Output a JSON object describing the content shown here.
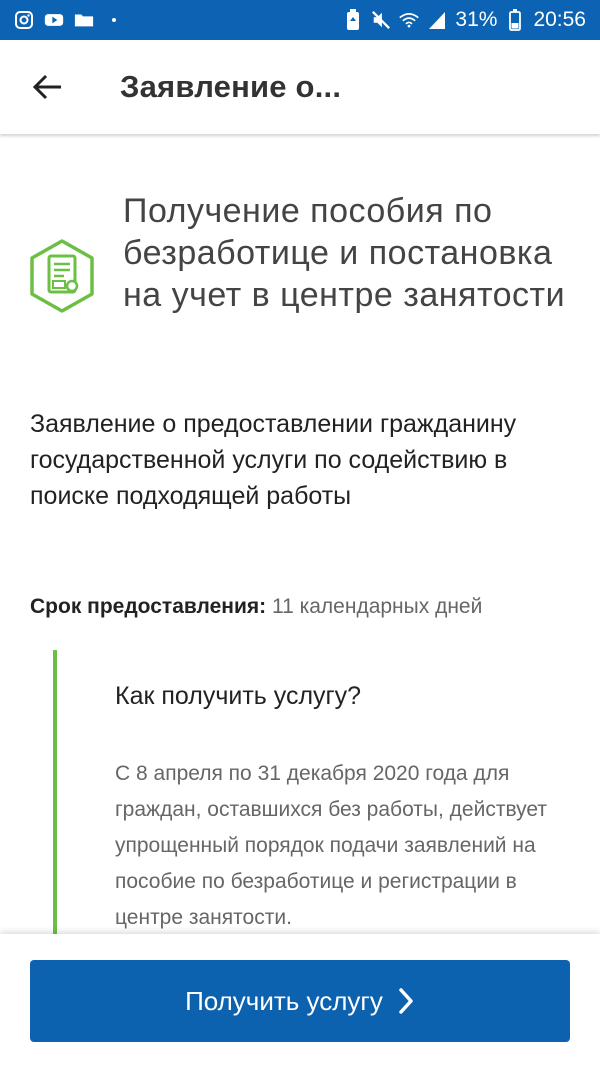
{
  "status_bar": {
    "battery": "31%",
    "time": "20:56",
    "icons": [
      "instagram-icon",
      "youtube-icon",
      "folder-icon",
      "dot-icon",
      "battery-saver-icon",
      "mute-icon",
      "wifi-icon",
      "signal-icon",
      "battery-icon"
    ]
  },
  "appbar": {
    "title": "Заявление о..."
  },
  "service": {
    "title": "Получение пособия по безработице и постановка на учет в центре занятости",
    "icon": "document-icon",
    "icon_color": "#6cbf45"
  },
  "application": {
    "title": "Заявление о предоставлении гражданину государственной услуги по содействию в поиске подходящей работы"
  },
  "term": {
    "label": "Срок предоставления:",
    "value": "11 календарных дней"
  },
  "howto": {
    "heading": "Как получить услугу?",
    "text": "С 8 апреля по 31 декабря 2020 года для граждан, оставшихся без работы, действует упрощенный порядок подачи заявлений на пособие по безработице и регистрации в центре занятости."
  },
  "footer": {
    "button_label": "Получить услугу"
  },
  "colors": {
    "primary": "#0c63b3",
    "accent": "#6cbf45"
  }
}
